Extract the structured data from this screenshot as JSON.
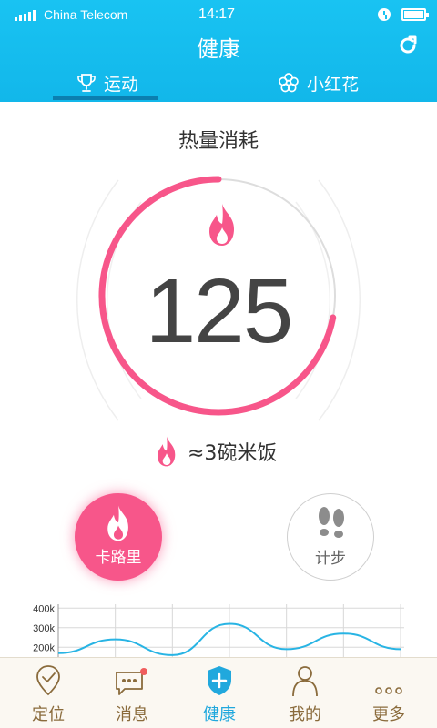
{
  "status_bar": {
    "carrier": "China Telecom",
    "time": "14:17",
    "icons": [
      "signal-icon",
      "alarm-icon",
      "battery-icon"
    ]
  },
  "header": {
    "title": "健康",
    "refresh_icon": "refresh-icon"
  },
  "tabs": [
    {
      "label": "运动",
      "icon": "trophy-icon",
      "active": true
    },
    {
      "label": "小红花",
      "icon": "flower-icon",
      "active": false
    }
  ],
  "main": {
    "section_title": "热量消耗",
    "calorie_value": "125",
    "ring_progress": 0.72,
    "equivalent_text": "≈3碗米饭",
    "buttons": [
      {
        "label": "卡路里",
        "icon": "flame-icon",
        "active": true
      },
      {
        "label": "计步",
        "icon": "footprints-icon",
        "active": false
      }
    ]
  },
  "chart_data": {
    "type": "line",
    "y_tick_labels": [
      "400k",
      "300k",
      "200k"
    ],
    "series": [
      {
        "values": [
          170,
          240,
          160,
          320,
          190,
          270,
          190
        ]
      }
    ],
    "ylim": [
      150,
      420
    ],
    "grid": true
  },
  "colors": {
    "header": "#19c3f2",
    "accent_pink": "#f7568a",
    "nav_text": "#8a6b3c",
    "nav_active": "#21a8dd"
  },
  "bottom_nav": [
    {
      "label": "定位",
      "icon": "location-icon",
      "active": false
    },
    {
      "label": "消息",
      "icon": "message-icon",
      "active": false
    },
    {
      "label": "健康",
      "icon": "health-shield-icon",
      "active": true
    },
    {
      "label": "我的",
      "icon": "person-icon",
      "active": false
    },
    {
      "label": "更多",
      "icon": "more-icon",
      "active": false
    }
  ]
}
